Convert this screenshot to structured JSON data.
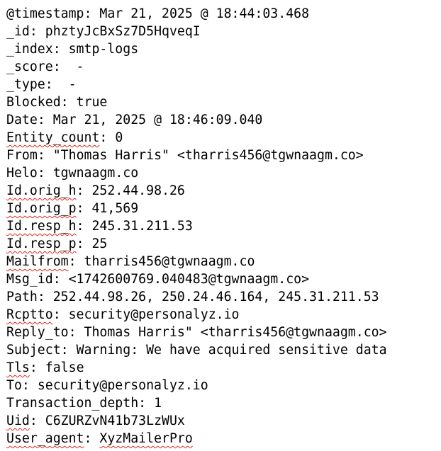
{
  "record": {
    "fields": [
      {
        "key": "@timestamp",
        "value": "Mar 21, 2025 @ 18:44:03.468"
      },
      {
        "key": "_id",
        "value": "phztyJcBxSz7D5HqveqI"
      },
      {
        "key": "_index",
        "value": "smtp-logs"
      },
      {
        "key": "_score",
        "value": " -"
      },
      {
        "key": "_type",
        "value": " -"
      },
      {
        "key": "Blocked",
        "value": "true"
      },
      {
        "key": "Date",
        "value": "Mar 21, 2025 @ 18:46:09.040"
      },
      {
        "key": "Entity_count",
        "value": "0"
      },
      {
        "key": "From",
        "value": "\"Thomas Harris\" <tharris456@tgwnaagm.co>"
      },
      {
        "key": "Helo",
        "value": "tgwnaagm.co"
      },
      {
        "key": "Id.orig_h",
        "value": "252.44.98.26"
      },
      {
        "key": "Id.orig_p",
        "value": "41,569"
      },
      {
        "key": "Id.resp_h",
        "value": "245.31.211.53"
      },
      {
        "key": "Id.resp_p",
        "value": "25"
      },
      {
        "key": "Mailfrom",
        "value": "tharris456@tgwnaagm.co"
      },
      {
        "key": "Msg_id",
        "value": "<1742600769.040483@tgwnaagm.co>"
      },
      {
        "key": "Path",
        "value": "252.44.98.26, 250.24.46.164, 245.31.211.53"
      },
      {
        "key": "Rcptto",
        "value": "security@personalyz.io"
      },
      {
        "key": "Reply_to",
        "value": "Thomas Harris\" <tharris456@tgwnaagm.co>"
      },
      {
        "key": "Subject",
        "value": "Warning: We have acquired sensitive data"
      },
      {
        "key": "Tls",
        "value": "false"
      },
      {
        "key": "To",
        "value": "security@personalyz.io"
      },
      {
        "key": "Transaction_depth",
        "value": "1"
      },
      {
        "key": "Uid",
        "value": "C6ZURZvN41b73LzWUx"
      },
      {
        "key": "User_agent",
        "value": "XyzMailerPro"
      }
    ],
    "separator": ": ",
    "spellcheck_underline_color": "#e0281e"
  }
}
